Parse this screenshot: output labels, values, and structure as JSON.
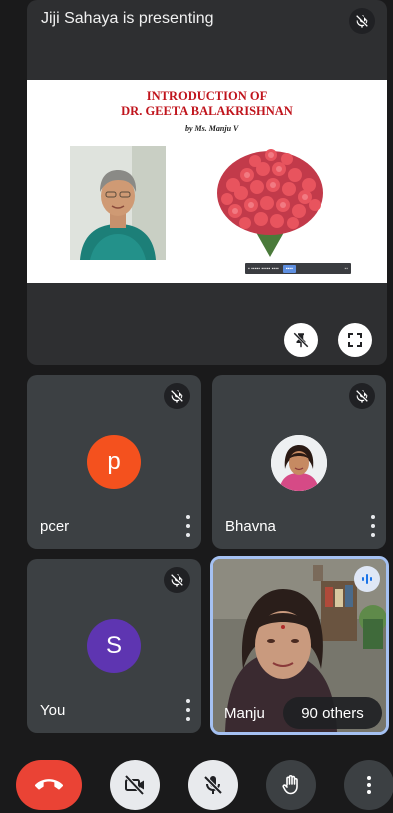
{
  "presentation": {
    "label": "Jiji Sahaya is presenting",
    "slide": {
      "title_line1": "INTRODUCTION OF",
      "title_line2": "DR. GEETA BALAKRISHNAN",
      "subtitle": "by Ms. Manju V"
    }
  },
  "participants": [
    {
      "name": "pcer",
      "initial": "p",
      "avatar_color": "#f4511e",
      "muted": true
    },
    {
      "name": "Bhavna",
      "muted": true
    },
    {
      "name": "You",
      "initial": "S",
      "avatar_color": "#5e35b1",
      "muted": true
    },
    {
      "name": "Manju",
      "speaking": true
    }
  ],
  "others_label": "90 others",
  "colors": {
    "hangup": "#ea4335",
    "speaking_border": "#a5c1f2"
  },
  "icons": {
    "mic_off": "mic-off-icon",
    "pin_off": "unpin-icon",
    "fullscreen": "fullscreen-icon",
    "camera_off": "camera-off-icon",
    "raise_hand": "raise-hand-icon",
    "more": "more-vert-icon",
    "hangup": "hangup-icon"
  }
}
